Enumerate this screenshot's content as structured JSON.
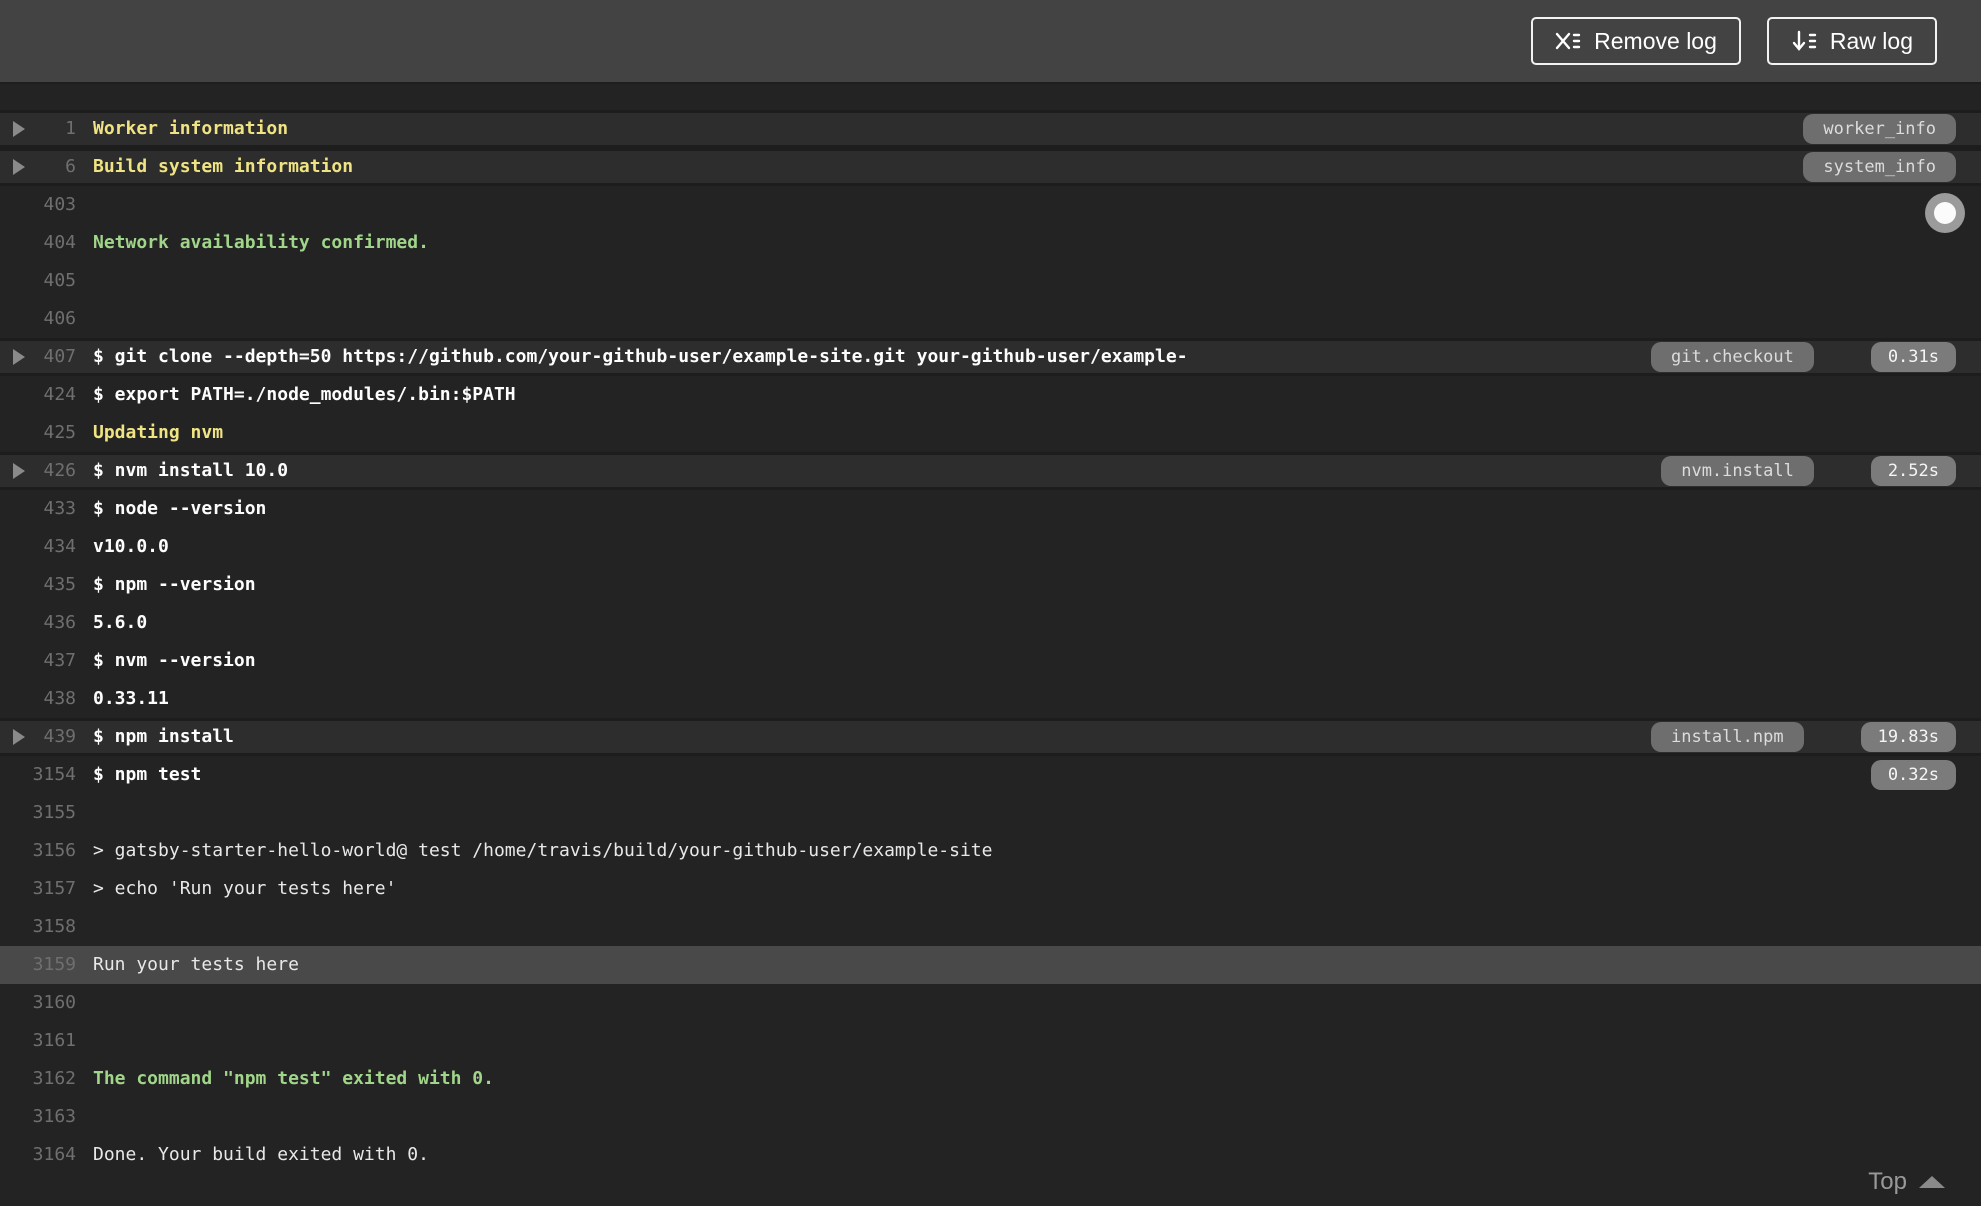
{
  "toolbar": {
    "remove_log_label": "Remove log",
    "raw_log_label": "Raw log"
  },
  "colors": {
    "page_background": "#232323",
    "header_background": "#434343",
    "fold_row_background": "#2d2d2d",
    "selected_row_background": "#494949",
    "title_yellow": "#efe383",
    "success_green": "#a0d58a",
    "command_white": "#fdfdfd",
    "tag_pill_background": "#6e6e6e",
    "time_pill_background": "#7b7b7b"
  },
  "log": {
    "top_link_label": "Top",
    "rows": [
      {
        "line": "1",
        "text": "Worker information",
        "kind": "title",
        "fold": true,
        "tag": "worker_info"
      },
      {
        "line": "6",
        "text": "Build system information",
        "kind": "title",
        "fold": true,
        "tag": "system_info"
      },
      {
        "line": "403",
        "text": "",
        "kind": "output"
      },
      {
        "line": "404",
        "text": "Network availability confirmed.",
        "kind": "success"
      },
      {
        "line": "405",
        "text": "",
        "kind": "output"
      },
      {
        "line": "406",
        "text": "",
        "kind": "output"
      },
      {
        "line": "407",
        "text": "$ git clone --depth=50 https://github.com/your-github-user/example-site.git your-github-user/example-",
        "kind": "command",
        "fold": true,
        "tag": "git.checkout",
        "time": "0.31s"
      },
      {
        "line": "424",
        "text": "$ export PATH=./node_modules/.bin:$PATH",
        "kind": "command"
      },
      {
        "line": "425",
        "text": "Updating nvm",
        "kind": "title"
      },
      {
        "line": "426",
        "text": "$ nvm install 10.0",
        "kind": "command",
        "fold": true,
        "tag": "nvm.install",
        "time": "2.52s"
      },
      {
        "line": "433",
        "text": "$ node --version",
        "kind": "command"
      },
      {
        "line": "434",
        "text": "v10.0.0",
        "kind": "strong"
      },
      {
        "line": "435",
        "text": "$ npm --version",
        "kind": "command"
      },
      {
        "line": "436",
        "text": "5.6.0",
        "kind": "strong"
      },
      {
        "line": "437",
        "text": "$ nvm --version",
        "kind": "command"
      },
      {
        "line": "438",
        "text": "0.33.11",
        "kind": "strong"
      },
      {
        "line": "439",
        "text": "$ npm install",
        "kind": "command",
        "fold": true,
        "tag": "install.npm",
        "time": "19.83s"
      },
      {
        "line": "3154",
        "text": "$ npm test",
        "kind": "command",
        "time": "0.32s"
      },
      {
        "line": "3155",
        "text": "",
        "kind": "output"
      },
      {
        "line": "3156",
        "text": "> gatsby-starter-hello-world@ test /home/travis/build/your-github-user/example-site",
        "kind": "output"
      },
      {
        "line": "3157",
        "text": "> echo 'Run your tests here'",
        "kind": "output"
      },
      {
        "line": "3158",
        "text": "",
        "kind": "output"
      },
      {
        "line": "3159",
        "text": "Run your tests here",
        "kind": "output",
        "selected": true
      },
      {
        "line": "3160",
        "text": "",
        "kind": "output"
      },
      {
        "line": "3161",
        "text": "",
        "kind": "output"
      },
      {
        "line": "3162",
        "text": "The command \"npm test\" exited with 0.",
        "kind": "success"
      },
      {
        "line": "3163",
        "text": "",
        "kind": "output"
      },
      {
        "line": "3164",
        "text": "Done. Your build exited with 0.",
        "kind": "output"
      }
    ]
  }
}
